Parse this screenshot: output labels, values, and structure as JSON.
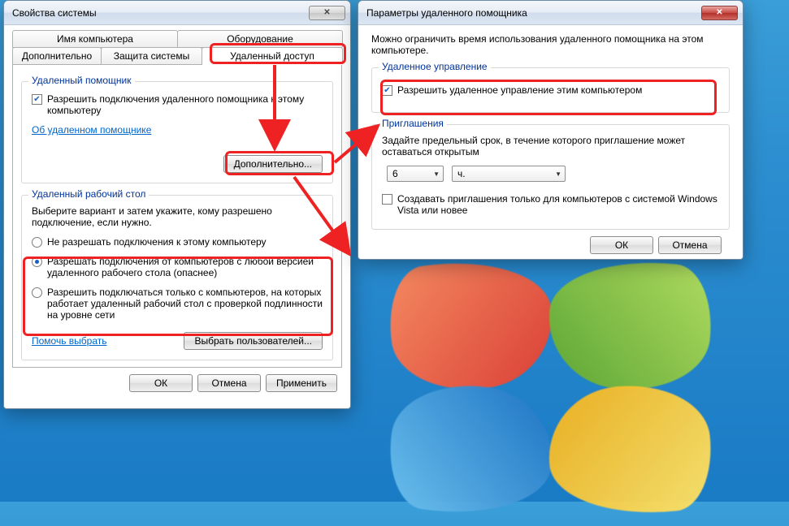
{
  "desktop": {
    "os_style": "windows-7"
  },
  "sys_dialog": {
    "title": "Свойства системы",
    "tabs_top": [
      "Имя компьютера",
      "Оборудование"
    ],
    "tabs_bottom": [
      "Дополнительно",
      "Защита системы",
      "Удаленный доступ"
    ],
    "assistant_group": {
      "legend": "Удаленный помощник",
      "allow_label": "Разрешить подключения удаленного помощника к этому компьютеру",
      "about_link": "Об удаленном помощнике",
      "advanced_btn": "Дополнительно..."
    },
    "rdp_group": {
      "legend": "Удаленный рабочий стол",
      "intro": "Выберите вариант и затем укажите, кому разрешено подключение, если нужно.",
      "opt1": "Не разрешать подключения к этому компьютеру",
      "opt2": "Разрешать подключения от компьютеров с любой версией удаленного рабочего стола (опаснее)",
      "opt3": "Разрешить подключаться только с компьютеров, на которых работает удаленный рабочий стол с проверкой подлинности на уровне сети",
      "help_link": "Помочь выбрать",
      "select_users_btn": "Выбрать пользователей..."
    },
    "buttons": {
      "ok": "ОК",
      "cancel": "Отмена",
      "apply": "Применить"
    }
  },
  "ra_dialog": {
    "title": "Параметры удаленного помощника",
    "intro": "Можно ограничить время использования удаленного помощника на этом компьютере.",
    "control_group": {
      "legend": "Удаленное управление",
      "allow_label": "Разрешить удаленное управление этим компьютером"
    },
    "invite_group": {
      "legend": "Приглашения",
      "desc": "Задайте предельный срок, в течение которого приглашение может оставаться открытым",
      "value": "6",
      "unit": "ч.",
      "vista_label": "Создавать приглашения только для компьютеров с системой Windows Vista или новее"
    },
    "buttons": {
      "ok": "ОК",
      "cancel": "Отмена"
    }
  }
}
